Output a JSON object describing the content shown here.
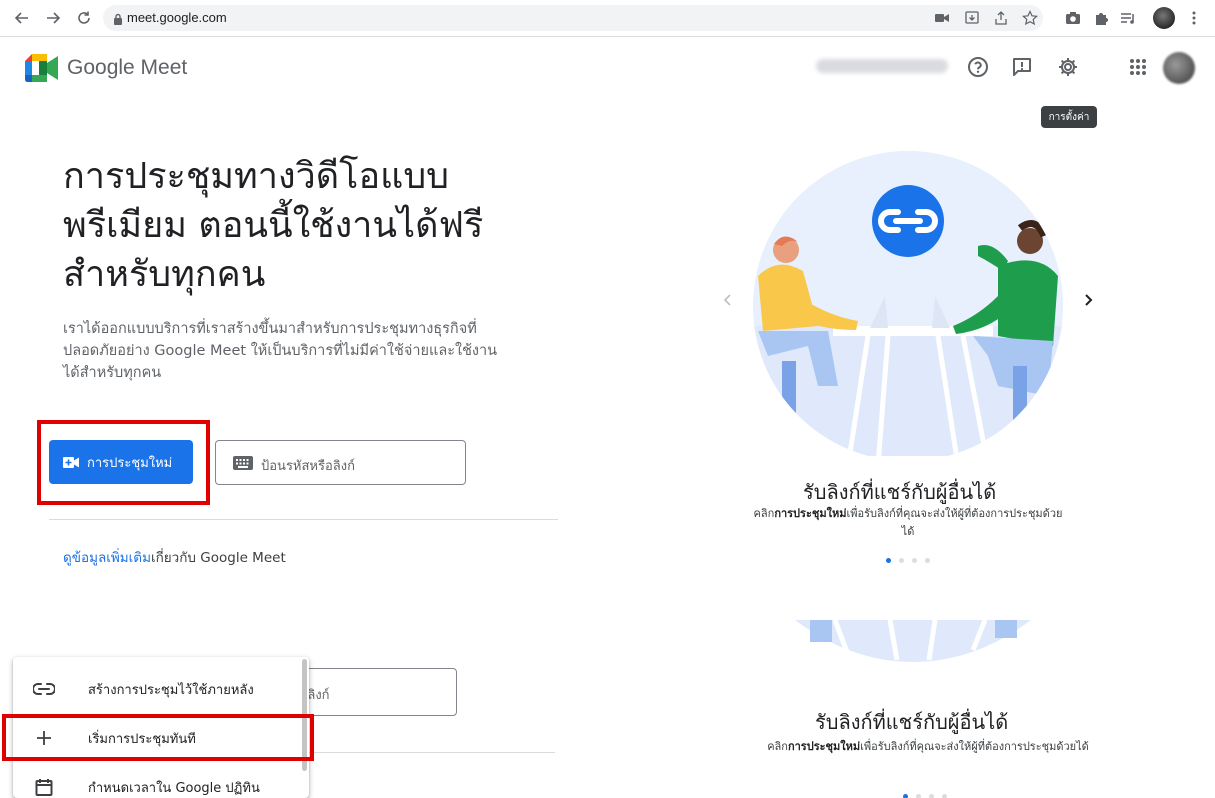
{
  "browser": {
    "url": "meet.google.com",
    "back_icon": "arrow-left-icon",
    "forward_icon": "arrow-right-icon",
    "reload_icon": "reload-icon",
    "lock_icon": "lock-icon"
  },
  "header": {
    "brand": "Google Meet",
    "help_icon": "help-icon",
    "feedback_icon": "feedback-icon",
    "settings_icon": "gear-icon",
    "apps_icon": "apps-grid-icon",
    "settings_tooltip": "การตั้งค่า"
  },
  "hero": {
    "title": "การประชุมทางวิดีโอแบบพรีเมียม ตอนนี้ใช้งานได้ฟรีสำหรับทุกคน",
    "description": "เราได้ออกแบบบริการที่เราสร้างขึ้นมาสำหรับการประชุมทางธุรกิจที่ปลอดภัยอย่าง Google Meet ให้เป็นบริการที่ไม่มีค่าใช้จ่ายและใช้งานได้สำหรับทุกคน",
    "new_meeting_label": "การประชุมใหม่",
    "code_placeholder": "ป้อนรหัสหรือลิงก์",
    "code_placeholder_partial": "หรือลิงก์",
    "learn_more_link": "ดูข้อมูลเพิ่มเติม",
    "learn_more_rest": "เกี่ยวกับ Google Meet"
  },
  "carousel": {
    "slide_title": "รับลิงก์ที่แชร์กับผู้อื่นได้",
    "slide_desc_prefix": "คลิก",
    "slide_desc_bold": "การประชุมใหม่",
    "slide_desc_suffix": "เพื่อรับลิงก์ที่คุณจะส่งให้ผู้ที่ต้องการประชุมด้วยได้",
    "prev_icon": "chevron-left-icon",
    "next_icon": "chevron-right-icon",
    "dots_total": 4,
    "dot_active": 1
  },
  "menu": {
    "items": [
      {
        "label": "สร้างการประชุมไว้ใช้ภายหลัง",
        "icon": "link-icon"
      },
      {
        "label": "เริ่มการประชุมทันที",
        "icon": "plus-icon"
      },
      {
        "label": "กำหนดเวลาใน Google ปฏิทิน",
        "icon": "calendar-icon"
      }
    ]
  },
  "colors": {
    "primary": "#1a73e8",
    "highlight": "#e00000",
    "tooltip_bg": "#3c4043"
  }
}
